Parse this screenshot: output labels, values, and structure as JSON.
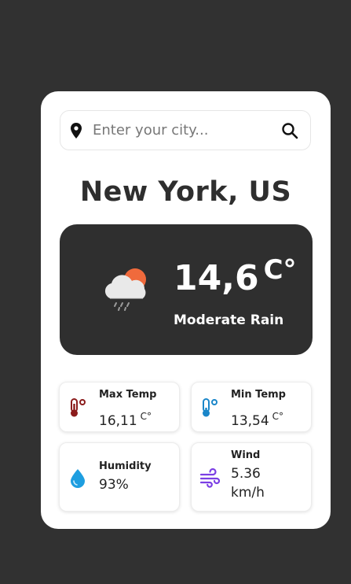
{
  "search": {
    "placeholder": "Enter your city...",
    "value": ""
  },
  "location": "New York, US",
  "current": {
    "temperature": "14,6",
    "unit": "C°",
    "description": "Moderate Rain"
  },
  "details": {
    "max_temp": {
      "label": "Max Temp",
      "value": "16,11",
      "unit": "C°"
    },
    "min_temp": {
      "label": "Min Temp",
      "value": "13,54",
      "unit": "C°"
    },
    "humidity": {
      "label": "Humidity",
      "value": "93%"
    },
    "wind": {
      "label": "Wind",
      "value": "5.36 km/h"
    }
  },
  "icons": {
    "location": "location-pin-icon",
    "search": "search-icon",
    "weather": "cloud-sun-rain-icon",
    "max_temp": "thermometer-hot-icon",
    "min_temp": "thermometer-cold-icon",
    "humidity": "water-drop-icon",
    "wind": "wind-icon"
  },
  "colors": {
    "background": "#313131",
    "card": "#ffffff",
    "panel": "#2f2f2f",
    "max_temp_icon": "#8b1c1c",
    "min_temp_icon": "#1a86c9",
    "humidity_icon": "#1e9ee0",
    "wind_icon": "#7b3fe4",
    "sun": "#f06a3c"
  }
}
